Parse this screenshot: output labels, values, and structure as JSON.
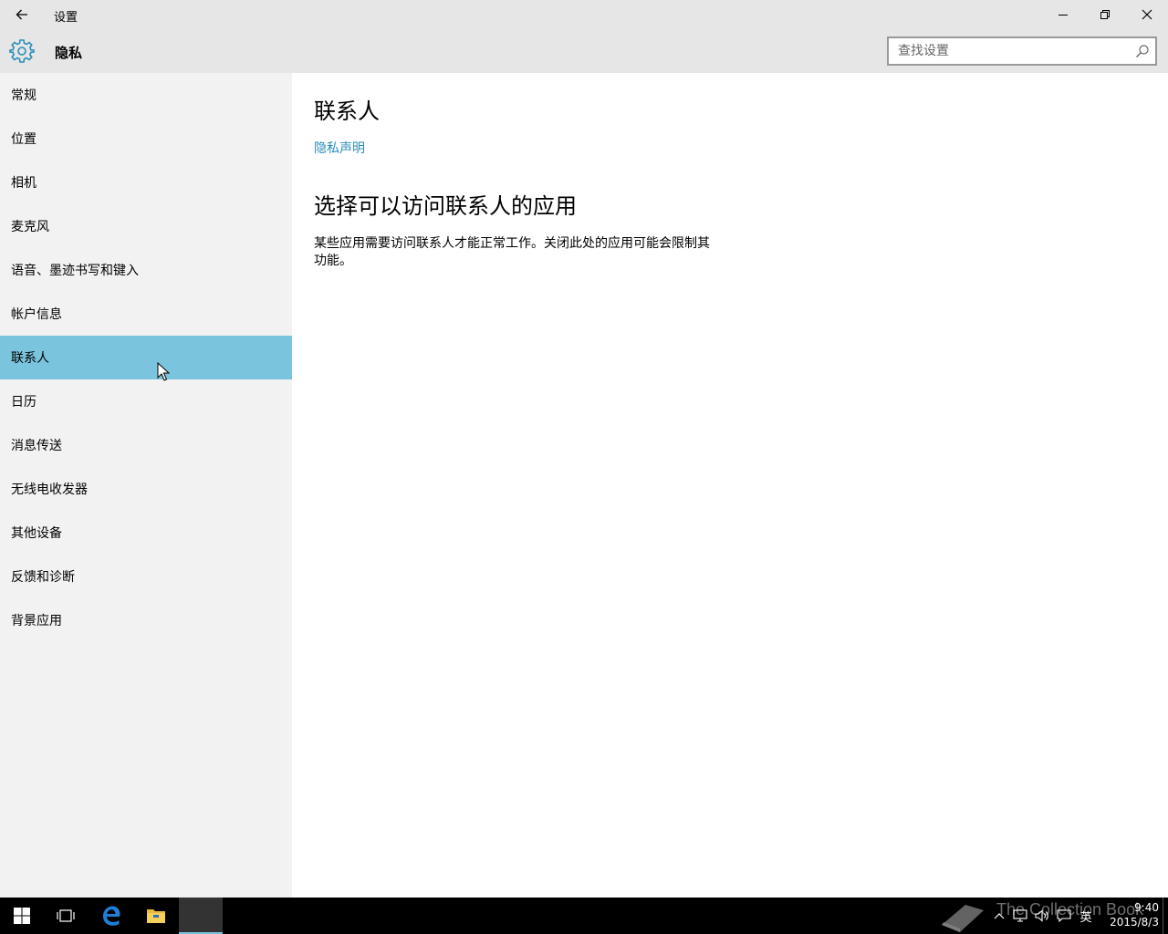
{
  "window": {
    "title": "设置"
  },
  "header": {
    "section_title": "隐私",
    "search_placeholder": "查找设置"
  },
  "sidebar": {
    "items": [
      {
        "label": "常规"
      },
      {
        "label": "位置"
      },
      {
        "label": "相机"
      },
      {
        "label": "麦克风"
      },
      {
        "label": "语音、墨迹书写和键入"
      },
      {
        "label": "帐户信息"
      },
      {
        "label": "联系人",
        "selected": true
      },
      {
        "label": "日历"
      },
      {
        "label": "消息传送"
      },
      {
        "label": "无线电收发器"
      },
      {
        "label": "其他设备"
      },
      {
        "label": "反馈和诊断"
      },
      {
        "label": "背景应用"
      }
    ]
  },
  "main": {
    "title": "联系人",
    "privacy_link": "隐私声明",
    "section_heading": "选择可以访问联系人的应用",
    "description": "某些应用需要访问联系人才能正常工作。关闭此处的应用可能会限制其功能。"
  },
  "taskbar": {
    "time": "9:40",
    "date": "2015/8/3",
    "ime": "英",
    "watermark": "The Collection Book"
  },
  "colors": {
    "accent": "#7bc4dd",
    "link": "#2a8db8",
    "chrome": "#e6e6e6",
    "sidebar": "#f2f2f2"
  },
  "icons": [
    "back-icon",
    "minimize-icon",
    "restore-icon",
    "close-icon",
    "gear-icon",
    "search-icon",
    "start-icon",
    "task-view-icon",
    "edge-icon",
    "file-explorer-icon",
    "chevron-up-icon",
    "network-icon",
    "volume-icon",
    "notification-icon"
  ]
}
